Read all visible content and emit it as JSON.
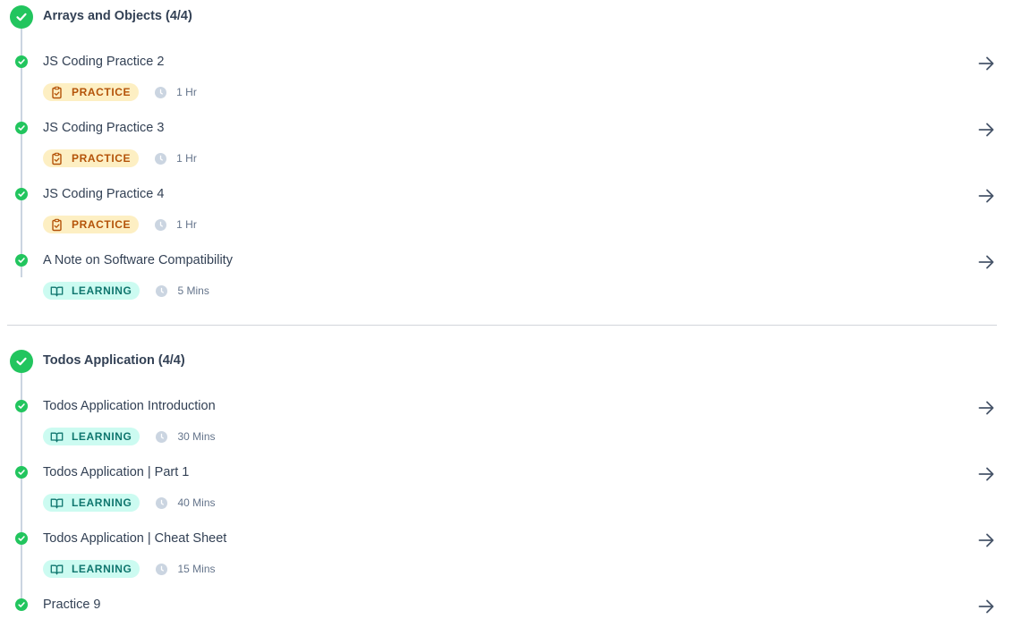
{
  "colors": {
    "complete_green": "#22c55e",
    "practice_badge_bg": "#fdefc3",
    "practice_badge_text": "#b45309",
    "learning_badge_bg": "#ccfbf1",
    "learning_badge_text": "#0f766e",
    "timeline": "#cbd5e1",
    "text": "#334155"
  },
  "sections": [
    {
      "title": "Arrays and Objects (4/4)",
      "status_icon": "check-circle-icon",
      "items": [
        {
          "title": "JS Coding Practice 2",
          "type": "PRACTICE",
          "type_icon": "clipboard-check-icon",
          "duration": "1 Hr",
          "status_icon": "check-circle-icon",
          "action_icon": "arrow-right-icon"
        },
        {
          "title": "JS Coding Practice 3",
          "type": "PRACTICE",
          "type_icon": "clipboard-check-icon",
          "duration": "1 Hr",
          "status_icon": "check-circle-icon",
          "action_icon": "arrow-right-icon"
        },
        {
          "title": "JS Coding Practice 4",
          "type": "PRACTICE",
          "type_icon": "clipboard-check-icon",
          "duration": "1 Hr",
          "status_icon": "check-circle-icon",
          "action_icon": "arrow-right-icon"
        },
        {
          "title": "A Note on Software Compatibility",
          "type": "LEARNING",
          "type_icon": "open-book-icon",
          "duration": "5 Mins",
          "status_icon": "check-circle-icon",
          "action_icon": "arrow-right-icon"
        }
      ]
    },
    {
      "title": "Todos Application (4/4)",
      "status_icon": "check-circle-icon",
      "items": [
        {
          "title": "Todos Application Introduction",
          "type": "LEARNING",
          "type_icon": "open-book-icon",
          "duration": "30 Mins",
          "status_icon": "check-circle-icon",
          "action_icon": "arrow-right-icon"
        },
        {
          "title": "Todos Application | Part 1",
          "type": "LEARNING",
          "type_icon": "open-book-icon",
          "duration": "40 Mins",
          "status_icon": "check-circle-icon",
          "action_icon": "arrow-right-icon"
        },
        {
          "title": "Todos Application | Cheat Sheet",
          "type": "LEARNING",
          "type_icon": "open-book-icon",
          "duration": "15 Mins",
          "status_icon": "check-circle-icon",
          "action_icon": "arrow-right-icon"
        },
        {
          "title": "Practice 9",
          "status_icon": "check-circle-icon",
          "action_icon": "arrow-right-icon"
        }
      ]
    }
  ]
}
